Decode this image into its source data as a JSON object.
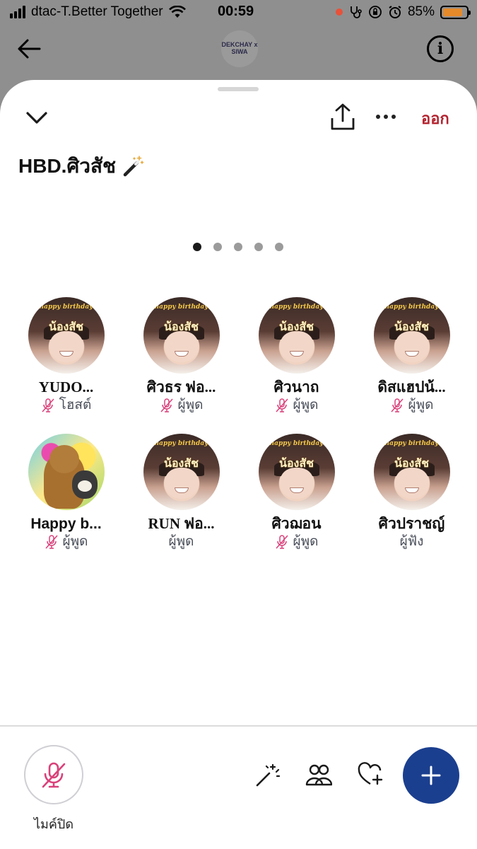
{
  "status_bar": {
    "carrier": "dtac-T.Better Together",
    "time": "00:59",
    "battery_percent": "85%",
    "battery_level": 0.85
  },
  "background_header": {
    "logo_text": "DEKCHAY x SIWA"
  },
  "sheet": {
    "leave_label": "ออก",
    "room_title": "HBD.ศิวสัช",
    "page_dots": {
      "count": 5,
      "active_index": 0
    }
  },
  "avatar_caption": {
    "line1": "happy birthday",
    "line2": "น้องสัช"
  },
  "participants": [
    {
      "name": "YUDO...",
      "role": "โฮสต์",
      "muted": true,
      "avatar": "birthday-photo"
    },
    {
      "name": "ศิวธร ฟอ...",
      "role": "ผู้พูด",
      "muted": true,
      "avatar": "birthday-photo"
    },
    {
      "name": "ศิวนาถ",
      "role": "ผู้พูด",
      "muted": true,
      "avatar": "birthday-photo"
    },
    {
      "name": "ดิสแฮปน้...",
      "role": "ผู้พูด",
      "muted": true,
      "avatar": "birthday-photo"
    },
    {
      "name": "Happy b...",
      "role": "ผู้พูด",
      "muted": true,
      "avatar": "bear-costume-photo"
    },
    {
      "name": "RUN ฟอ...",
      "role": "ผู้พูด",
      "muted": false,
      "avatar": "birthday-photo"
    },
    {
      "name": "ศิวฌอน",
      "role": "ผู้พูด",
      "muted": true,
      "avatar": "birthday-photo"
    },
    {
      "name": "ศิวปราชญ์",
      "role": "ผู้ฟัง",
      "muted": false,
      "avatar": "birthday-photo"
    }
  ],
  "bottom_bar": {
    "mic_label": "ไมค์ปิด",
    "icons": [
      "mic-off-icon",
      "magic-wand-icon",
      "people-icon",
      "heart-plus-icon",
      "plus-icon"
    ],
    "fab_color": "#1b3f8f"
  },
  "colors": {
    "leave": "#b3232f",
    "mic_off": "#d9417a",
    "role_text": "#4a4f5a"
  }
}
